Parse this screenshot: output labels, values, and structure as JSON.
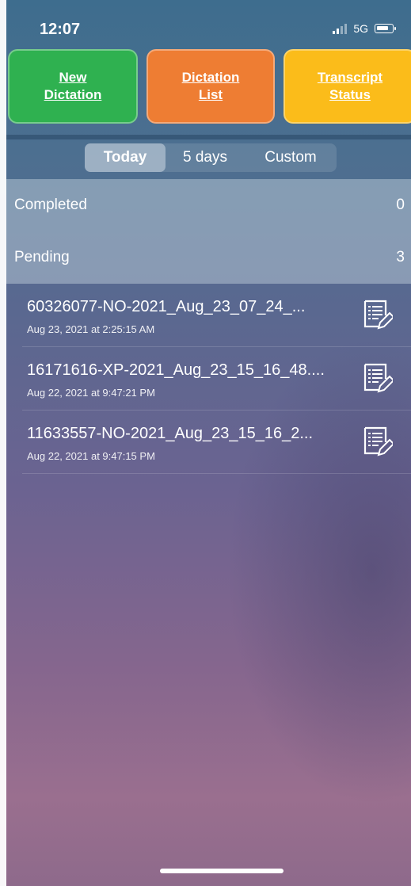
{
  "status_bar": {
    "time": "12:07",
    "network": "5G"
  },
  "actions": {
    "new_dictation": "New\nDictation",
    "dictation_list": "Dictation\nList",
    "transcript_status": "Transcript\nStatus"
  },
  "action_colors": {
    "new": "#2fb150",
    "list": "#ee7d33",
    "status": "#fbbc1a"
  },
  "segments": {
    "today": "Today",
    "five_days": "5 days",
    "custom": "Custom",
    "selected": "Today"
  },
  "sections": {
    "completed": {
      "label": "Completed",
      "count": "0"
    },
    "pending": {
      "label": "Pending",
      "count": "3"
    }
  },
  "items": [
    {
      "title": "60326077-NO-2021_Aug_23_07_24_...",
      "date": "Aug 23, 2021 at 2:25:15 AM",
      "icon": "document-edit-icon"
    },
    {
      "title": "16171616-XP-2021_Aug_23_15_16_48....",
      "date": "Aug 22, 2021 at 9:47:21 PM",
      "icon": "document-edit-icon"
    },
    {
      "title": "11633557-NO-2021_Aug_23_15_16_2...",
      "date": "Aug 22, 2021 at 9:47:15 PM",
      "icon": "document-edit-icon"
    }
  ]
}
